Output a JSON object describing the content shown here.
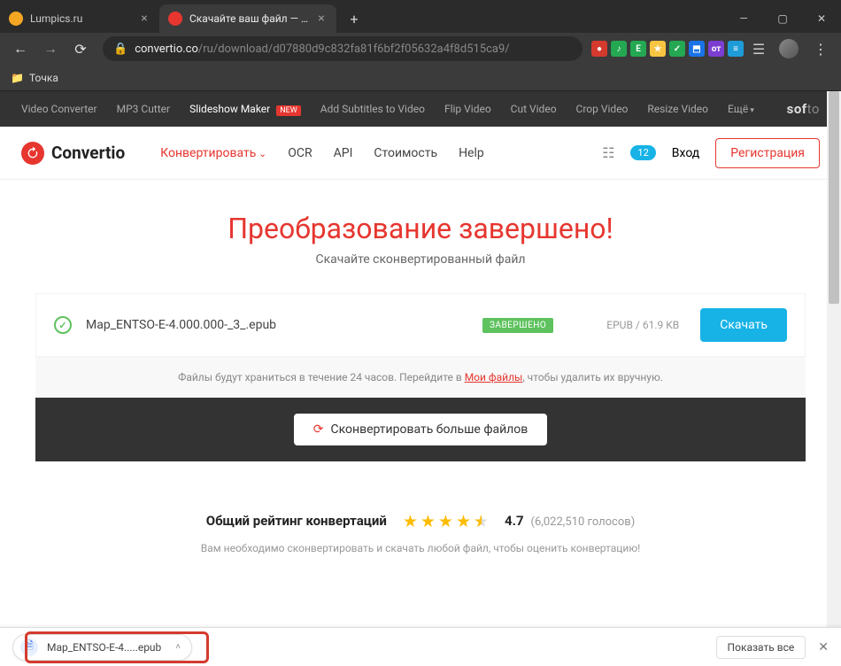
{
  "browser": {
    "tabs": [
      {
        "title": "Lumpics.ru",
        "favicon_color": "#f5a623"
      },
      {
        "title": "Скачайте ваш файл — Convertio",
        "favicon_color": "#e6362f"
      }
    ],
    "url_domain": "convertio.co",
    "url_path": "/ru/download/d07880d9c832fa81f6bf2f05632a4f8d515ca9/",
    "bookmarks": [
      {
        "label": "Точка"
      }
    ],
    "extensions_colors": [
      "#d43b2e",
      "#24a852",
      "#24a852",
      "#f7c542",
      "#24a852",
      "#1a73e8",
      "#7c3ed1",
      "#1e9cd7"
    ],
    "credits_badge": "12"
  },
  "softo_menu": {
    "items": [
      "Video Converter",
      "MP3 Cutter",
      "Slideshow Maker",
      "Add Subtitles to Video",
      "Flip Video",
      "Cut Video",
      "Crop Video",
      "Resize Video"
    ],
    "new_badge": "NEW",
    "more": "Ещё",
    "logo": "softo"
  },
  "header": {
    "logo": "Convertio",
    "menu": {
      "convert": "Конвертировать",
      "ocr": "OCR",
      "api": "API",
      "pricing": "Стоимость",
      "help": "Help"
    },
    "credits": "12",
    "login": "Вход",
    "register": "Регистрация"
  },
  "main": {
    "title": "Преобразование завершено!",
    "subtitle": "Скачайте сконвертированный файл",
    "file": {
      "name": "Map_ENTSO-E-4.000.000-_3_.epub",
      "status": "ЗАВЕРШЕНО",
      "format": "EPUB",
      "size": "61.9 KB",
      "download": "Скачать"
    },
    "note_pre": "Файлы будут храниться в течение 24 часов. Перейдите в ",
    "note_link": "Мои файлы",
    "note_post": ", чтобы удалить их вручную.",
    "convert_more": "Сконвертировать больше файлов"
  },
  "rating": {
    "title": "Общий рейтинг конвертаций",
    "value": "4.7",
    "count": "(6,022,510 голосов)",
    "sub": "Вам необходимо сконвертировать и скачать любой файл, чтобы оценить конвертацию!"
  },
  "shelf": {
    "file": "Map_ENTSO-E-4.....epub",
    "show_all": "Показать все"
  }
}
